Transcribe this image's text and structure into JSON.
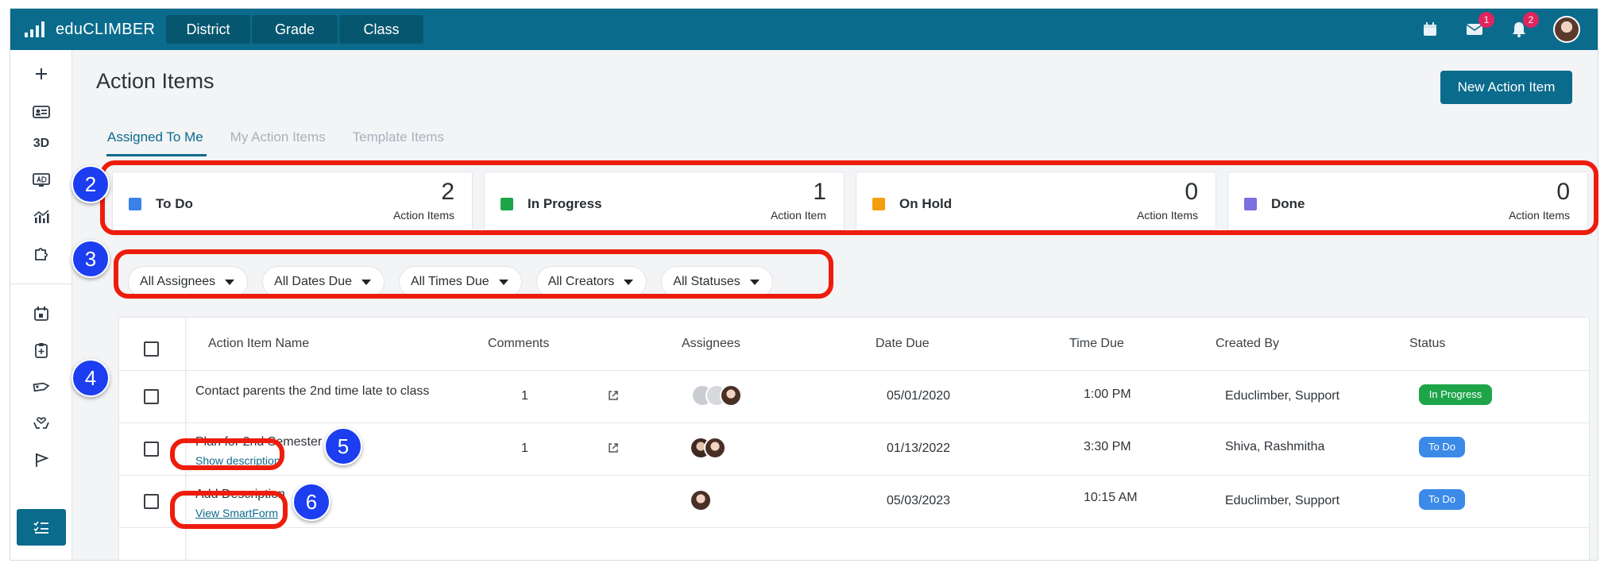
{
  "app": {
    "name": "eduCLIMBER"
  },
  "header": {
    "tabs": [
      "District",
      "Grade",
      "Class"
    ],
    "mail_badge": "1",
    "notif_badge": "2"
  },
  "sidebar": {
    "label_3d": "3D"
  },
  "page": {
    "title": "Action Items",
    "new_button": "New Action Item",
    "subtabs": [
      "Assigned To Me",
      "My Action Items",
      "Template Items"
    ]
  },
  "status_cards": [
    {
      "label": "To Do",
      "count": "2",
      "unit": "Action Items",
      "color": "#3b82e8"
    },
    {
      "label": "In Progress",
      "count": "1",
      "unit": "Action Item",
      "color": "#1ea54a"
    },
    {
      "label": "On Hold",
      "count": "0",
      "unit": "Action Items",
      "color": "#f59e0b"
    },
    {
      "label": "Done",
      "count": "0",
      "unit": "Action Items",
      "color": "#7c6fe0"
    }
  ],
  "filters": [
    "All Assignees",
    "All Dates Due",
    "All Times Due",
    "All Creators",
    "All Statuses"
  ],
  "table": {
    "headers": [
      "Action Item Name",
      "Comments",
      "Assignees",
      "Date Due",
      "Time Due",
      "Created By",
      "Status"
    ],
    "rows": [
      {
        "name": "Contact parents the 2nd time late to class",
        "comments": "1",
        "date": "05/01/2020",
        "time": "1:00 PM",
        "created_by": "Educlimber, Support",
        "status": "In Progress",
        "status_color": "#1ea54a"
      },
      {
        "name": "Plan for 2nd Semester",
        "link": "Show description",
        "comments": "1",
        "date": "01/13/2022",
        "time": "3:30 PM",
        "created_by": "Shiva, Rashmitha",
        "status": "To Do",
        "status_color": "#3b8ae8"
      },
      {
        "name": "Add Description",
        "link": "View SmartForm",
        "comments": "",
        "date": "05/03/2023",
        "time": "10:15 AM",
        "created_by": "Educlimber, Support",
        "status": "To Do",
        "status_color": "#3b8ae8"
      }
    ]
  },
  "callouts": [
    "2",
    "3",
    "4",
    "5",
    "6"
  ],
  "colors": {
    "brand": "#0b6b8c",
    "highlight": "#ee1c0c",
    "callout": "#1c3ef0"
  }
}
